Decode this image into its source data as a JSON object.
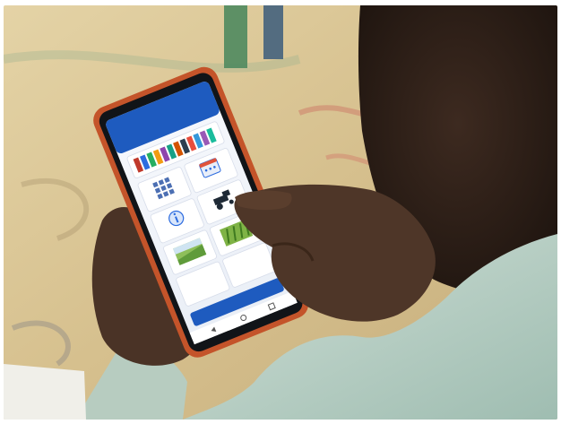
{
  "photo": {
    "subject": "farmer-using-smartphone-app",
    "colors": {
      "tarp": "#d9c79a",
      "shirt": "#b9d0c4",
      "skin": "#4a3326",
      "phone_case": "#c4542a",
      "app_blue": "#1e5bbf"
    }
  },
  "phone": {
    "app": {
      "header_title": "",
      "header_subtitle": "",
      "bottom_button": "",
      "tiles": [
        {
          "icon": "grid-icon"
        },
        {
          "icon": "calendar-icon"
        },
        {
          "icon": "info-icon"
        },
        {
          "icon": "tractor-icon"
        },
        {
          "icon": "field-icon"
        },
        {
          "icon": "crop-icon"
        },
        {
          "icon": "blank-icon"
        },
        {
          "icon": "blank-icon"
        }
      ]
    }
  }
}
